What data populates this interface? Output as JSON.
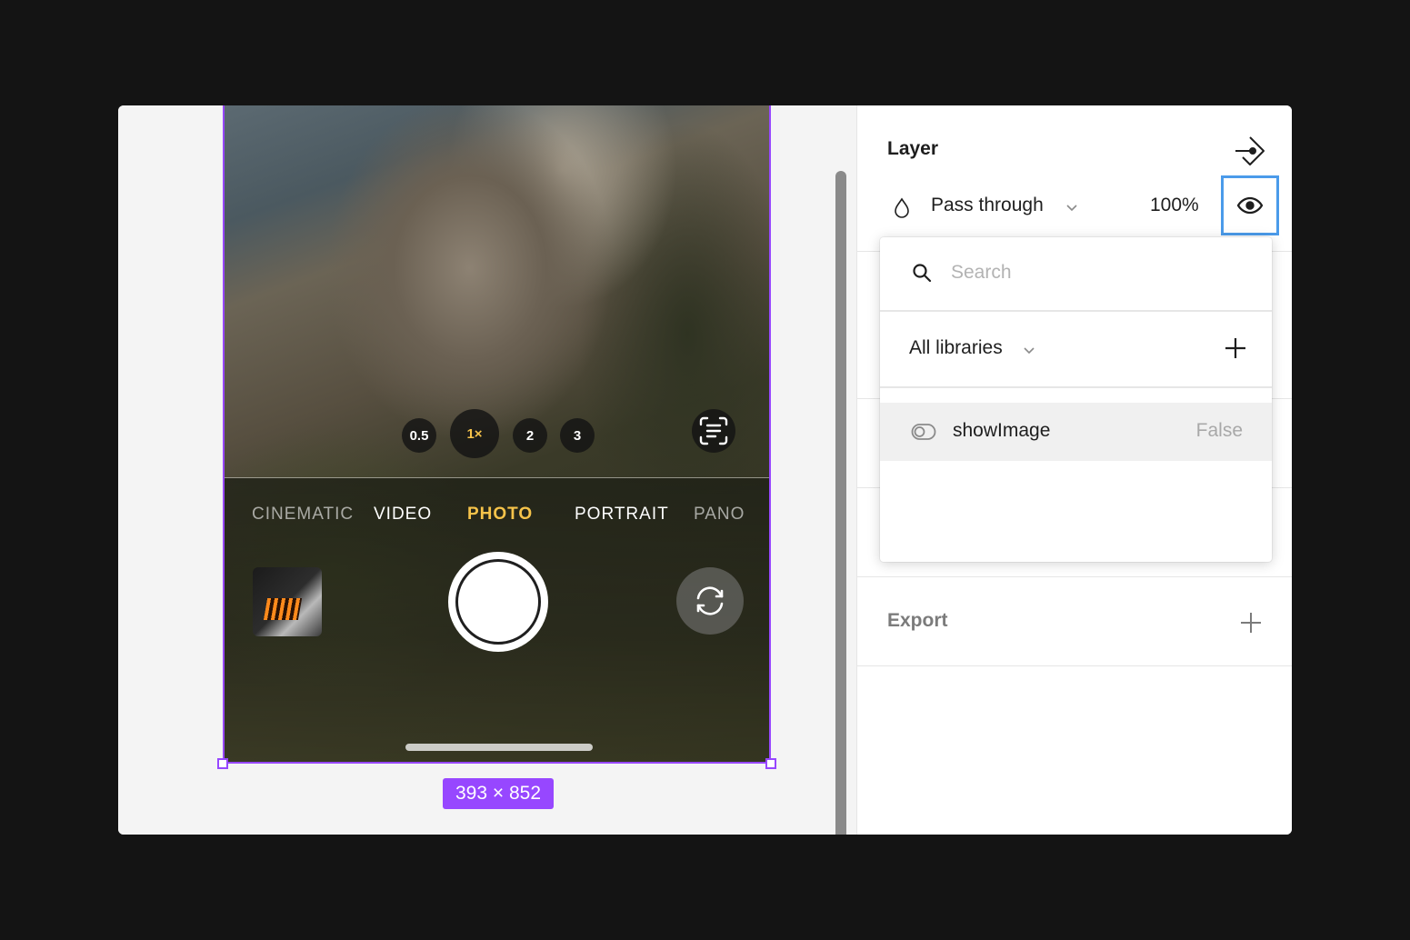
{
  "canvas": {
    "zoom_levels": [
      "0.5",
      "1×",
      "2",
      "3"
    ],
    "active_zoom": "1×",
    "modes": [
      "CINEMATIC",
      "VIDEO",
      "PHOTO",
      "PORTRAIT",
      "PANO"
    ],
    "active_mode": "PHOTO",
    "frame_size": "393 × 852",
    "selection_color": "#9747ff"
  },
  "panel": {
    "layer_title": "Layer",
    "blend_mode": "Pass through",
    "opacity": "100%",
    "export_title": "Export",
    "focus_color": "#4b9bea"
  },
  "popover": {
    "search_placeholder": "Search",
    "library_filter": "All libraries",
    "variables": [
      {
        "name": "showImage",
        "value": "False",
        "type": "boolean"
      }
    ]
  }
}
